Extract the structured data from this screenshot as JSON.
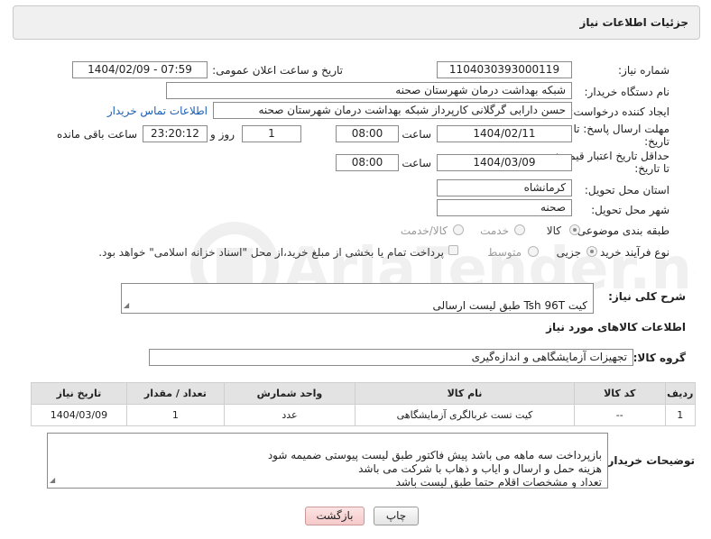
{
  "header": {
    "title": "جزئیات اطلاعات نیاز"
  },
  "fields": {
    "need_number": {
      "label": "شماره نیاز:",
      "value": "1104030393000119"
    },
    "announce": {
      "label": "تاریخ و ساعت اعلان عمومی:",
      "value": "1404/02/09 - 07:59"
    },
    "buyer_org": {
      "label": "نام دستگاه خریدار:",
      "value": "شبکه بهداشت درمان شهرستان صحنه"
    },
    "creator": {
      "label": "ایجاد کننده درخواست:",
      "value": "حسن دارابی گرگلانی کارپرداز شبکه بهداشت درمان شهرستان صحنه",
      "contact_link": "اطلاعات تماس خریدار"
    },
    "reply_deadline": {
      "label_line1": "مهلت ارسال پاسخ: تا",
      "label_line2": "تاریخ:",
      "date": "1404/02/11",
      "time_label": "ساعت",
      "time": "08:00",
      "days": "1",
      "days_label": "روز و",
      "remaining": "23:20:12",
      "remaining_label": "ساعت باقی مانده"
    },
    "price_validity": {
      "label_line1": "حداقل تاریخ اعتبار قیمت:",
      "label_line2": "تا تاریخ:",
      "date": "1404/03/09",
      "time_label": "ساعت",
      "time": "08:00"
    },
    "province": {
      "label": "استان محل تحویل:",
      "value": "کرمانشاه"
    },
    "city": {
      "label": "شهر محل تحویل:",
      "value": "صحنه"
    },
    "category": {
      "label": "طبقه بندی موضوعی:",
      "options": [
        "کالا",
        "خدمت",
        "کالا/خدمت"
      ],
      "selected": "کالا"
    },
    "purchase_type": {
      "label": "نوع فرآیند خرید :",
      "options": [
        "جزیی",
        "متوسط"
      ],
      "selected": "جزیی",
      "payment_note": "پرداخت تمام یا بخشی از مبلغ خرید،از محل \"اسناد خزانه اسلامی\" خواهد بود."
    }
  },
  "general_desc": {
    "label": "شرح کلی نیاز:",
    "value": "کیت  Tsh 96T طبق لیست ارسالی"
  },
  "goods_section": {
    "title": "اطلاعات کالاهای مورد نیاز"
  },
  "goods_group": {
    "label": "گروه کالا:",
    "value": "تجهیزات آزمایشگاهی و اندازه‌گیری"
  },
  "table": {
    "columns": [
      "ردیف",
      "کد کالا",
      "نام کالا",
      "واحد شمارش",
      "تعداد / مقدار",
      "تاریخ نیاز"
    ],
    "rows": [
      [
        "1",
        "--",
        "کیت تست غربالگری آزمایشگاهی",
        "عدد",
        "1",
        "1404/03/09"
      ]
    ]
  },
  "buyer_notes": {
    "label": "توضیحات خریدار:",
    "value": "بازپرداخت سه ماهه می باشد پیش فاکتور طبق لیست پیوستی ضمیمه شود\nهزینه حمل و ارسال و ایاب و ذهاب با شرکت می باشد\nتعداد و مشخصات اقلام حتما طبق لیست باشد"
  },
  "buttons": {
    "print": "چاپ",
    "back": "بازگشت"
  },
  "watermark": {
    "text": "AriaTender.net"
  }
}
